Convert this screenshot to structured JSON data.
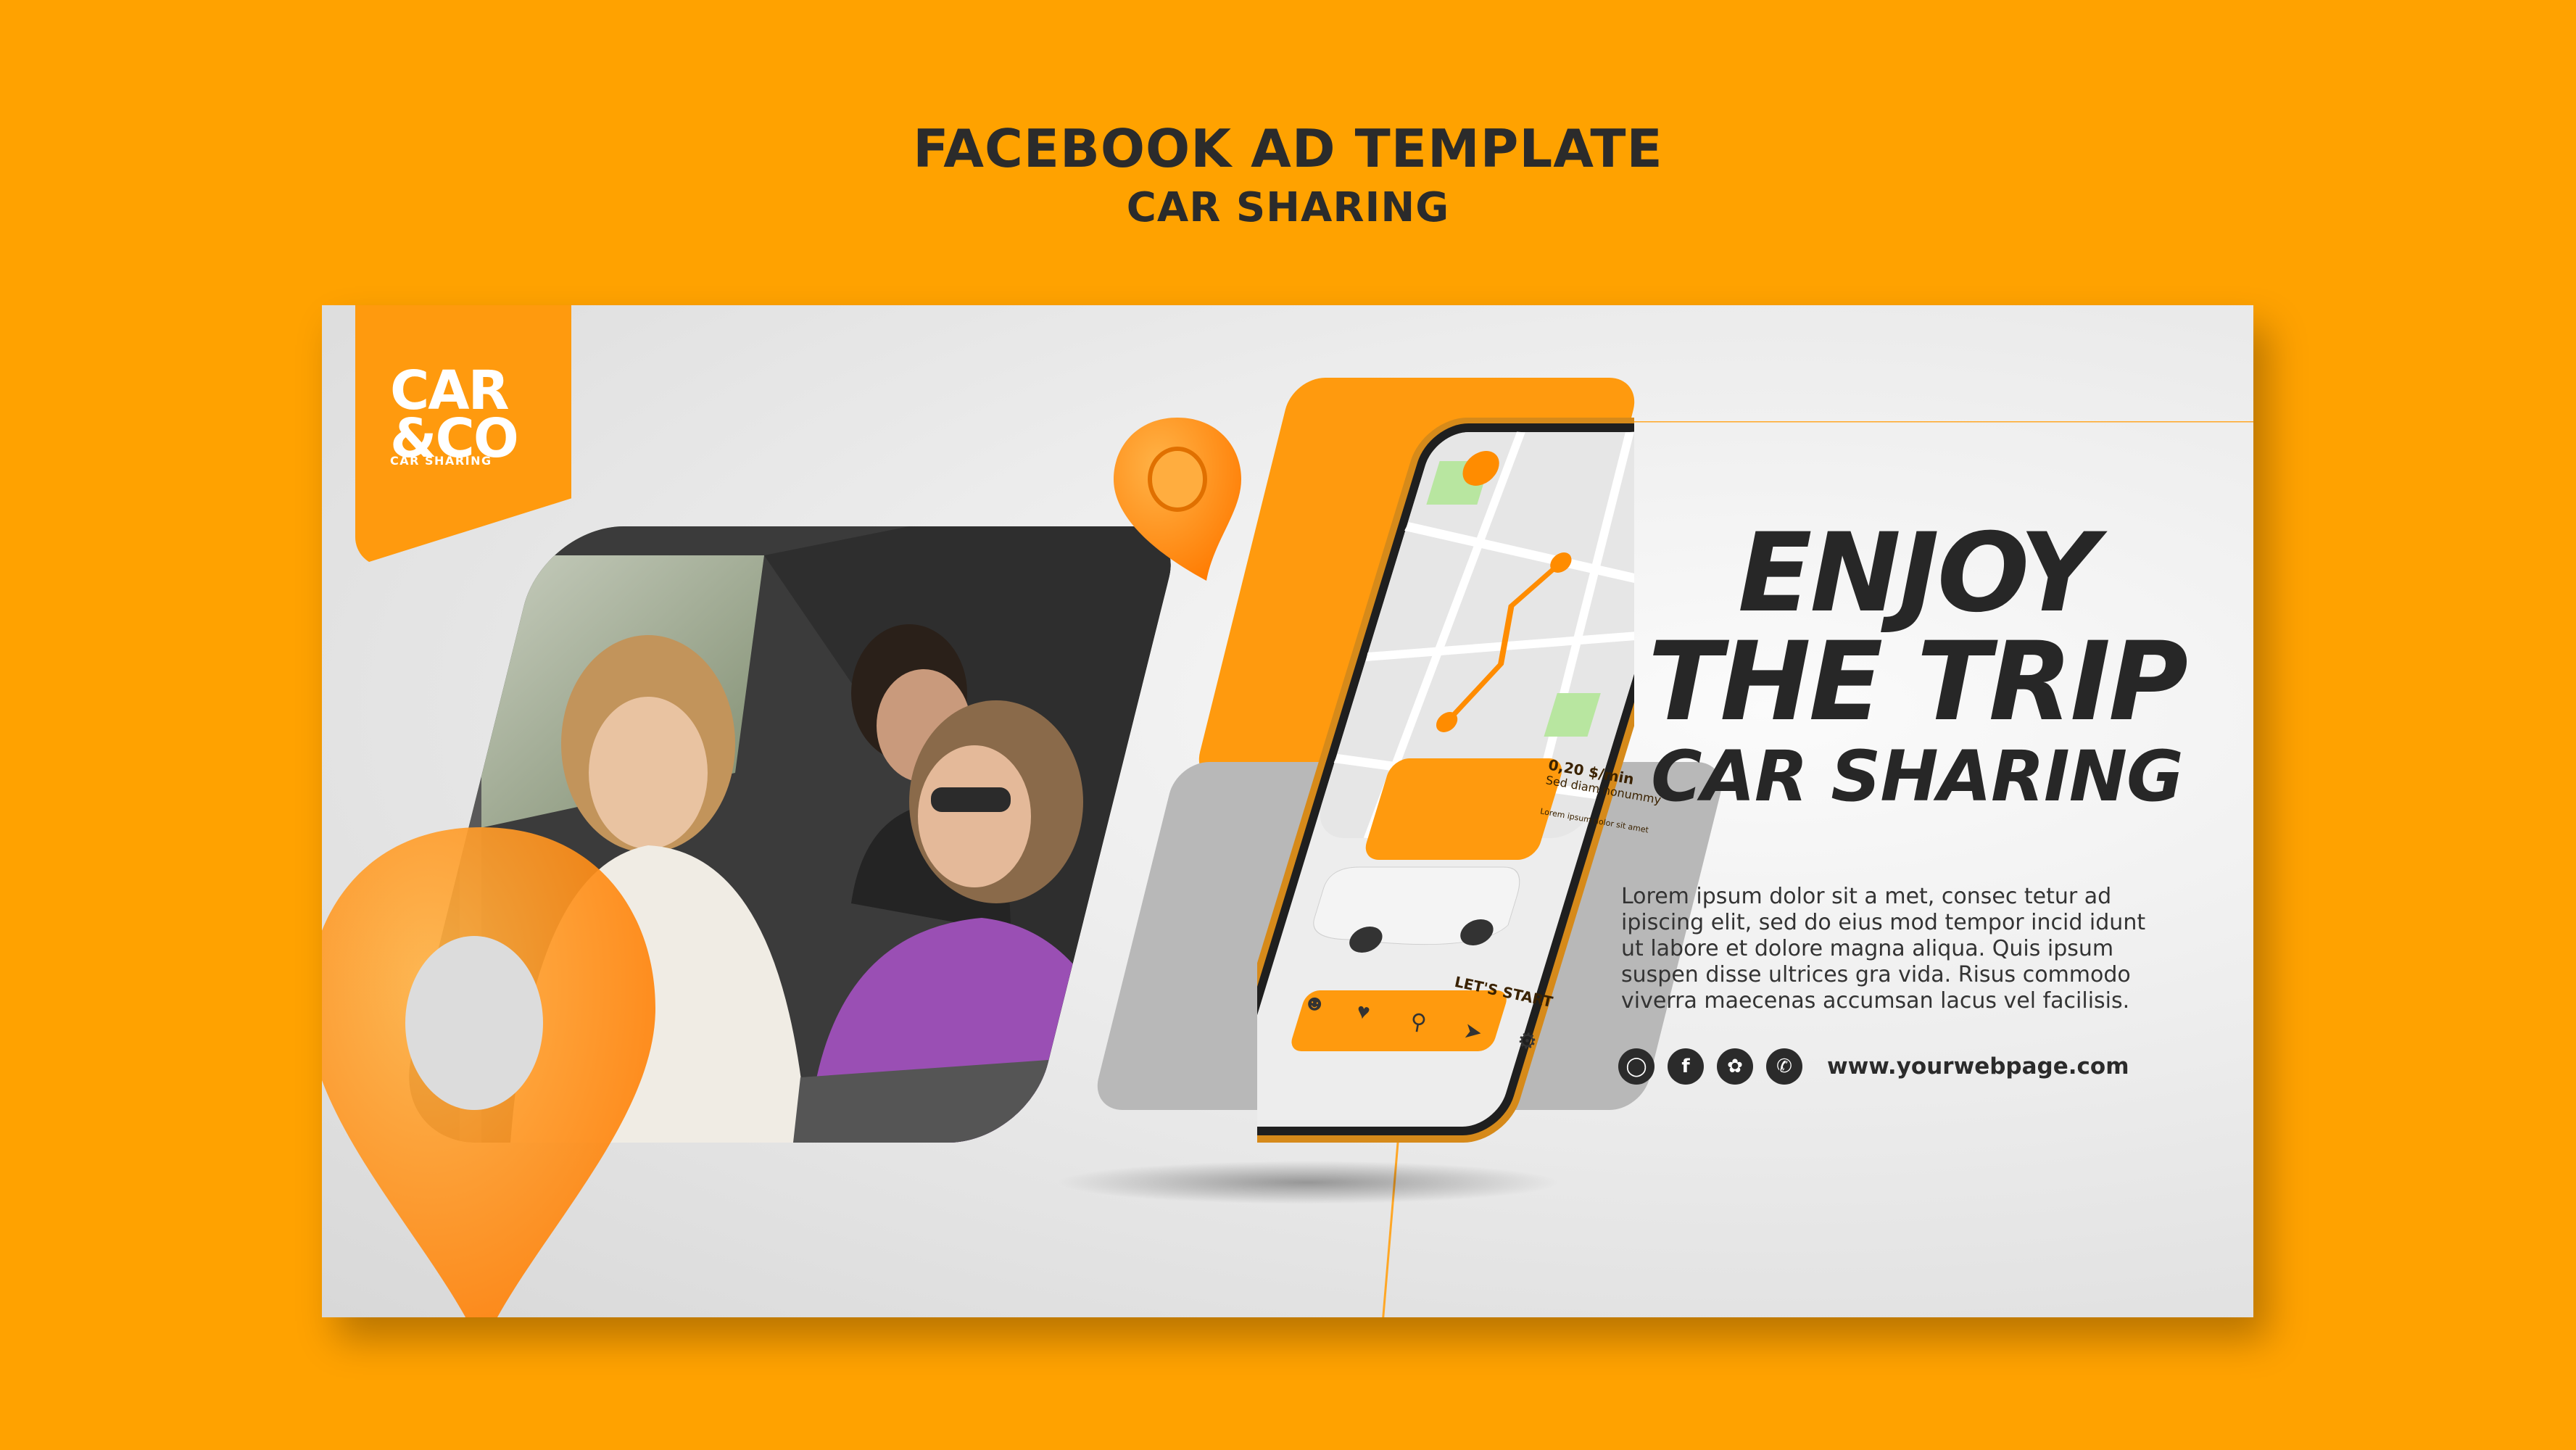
{
  "header": {
    "title": "FACEBOOK AD TEMPLATE",
    "subtitle": "CAR SHARING"
  },
  "logo": {
    "line1": "CAR",
    "line2": "&CO",
    "tagline": "CAR SHARING"
  },
  "phone_app": {
    "price": "0,20 $/min",
    "promo_line": "Sed diam nonummy",
    "detail_line": "Lorem ipsum dolor sit amet",
    "cta": "LET'S START",
    "nav_icons": [
      "user-icon",
      "heart-icon",
      "map-pin-icon",
      "navigation-icon",
      "settings-icon"
    ]
  },
  "headline": {
    "line1": "ENJOY",
    "line2": "THE TRIP",
    "line3": "CAR SHARING"
  },
  "body": "Lorem ipsum dolor sit a met, consec tetur ad ipiscing elit, sed do eius mod tempor incid idunt ut labore et dolore magna aliqua. Quis ipsum suspen disse ultrices gra vida. Risus commodo viverra maecenas accumsan lacus vel facilisis.",
  "socials": {
    "icons": [
      "instagram-icon",
      "facebook-icon",
      "twitter-icon",
      "whatsapp-icon"
    ],
    "url": "www.yourwebpage.com"
  },
  "colors": {
    "background": "#FFA200",
    "accent": "#FF9A0E",
    "text": "#272727"
  }
}
